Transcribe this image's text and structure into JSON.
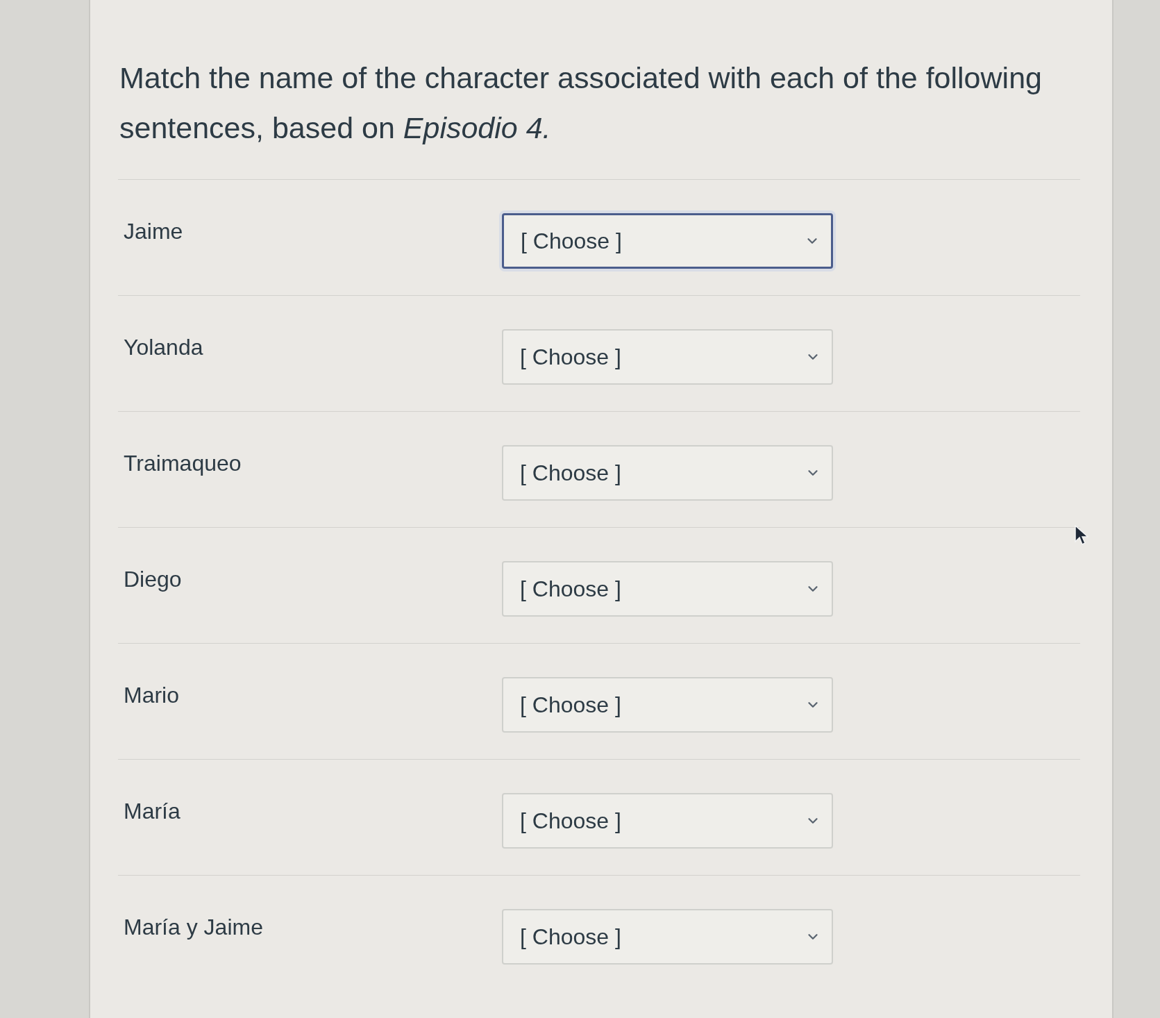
{
  "question": {
    "prompt": "Match the name of the character associated with each of the following sentences, based on *Episodio 4.*"
  },
  "rows": [
    {
      "label": "Jaime",
      "select": {
        "value": "[ Choose ]",
        "focused": true
      }
    },
    {
      "label": "Yolanda",
      "select": {
        "value": "[ Choose ]",
        "focused": false
      }
    },
    {
      "label": "Traimaqueo",
      "select": {
        "value": "[ Choose ]",
        "focused": false
      }
    },
    {
      "label": "Diego",
      "select": {
        "value": "[ Choose ]",
        "focused": false
      }
    },
    {
      "label": "Mario",
      "select": {
        "value": "[ Choose ]",
        "focused": false
      }
    },
    {
      "label": "María",
      "select": {
        "value": "[ Choose ]",
        "focused": false
      }
    },
    {
      "label": "María y Jaime",
      "select": {
        "value": "[ Choose ]",
        "focused": false
      }
    }
  ]
}
